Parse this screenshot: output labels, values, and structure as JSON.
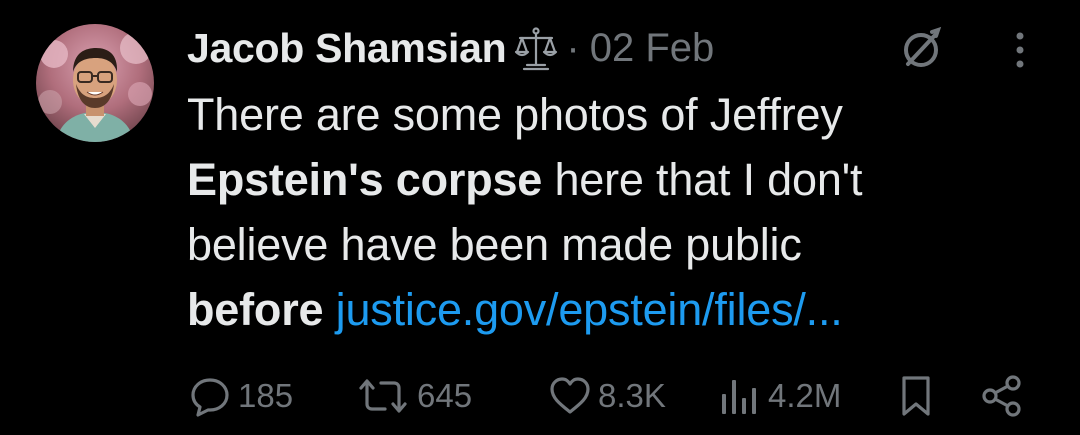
{
  "tweet": {
    "author": {
      "display_name": "Jacob Shamsian",
      "badge_icon": "scales-of-justice-icon"
    },
    "dot": "·",
    "timestamp": "02 Feb",
    "body": {
      "line1": "There are some photos of Jeffrey",
      "bold1": "Epstein's corpse",
      "line2_rest": " here that I don't",
      "line3": "believe have been made public",
      "bold2": "before",
      "link": "justice.gov/epstein/files/..."
    },
    "metrics": {
      "replies": "185",
      "reposts": "645",
      "likes": "8.3K",
      "views": "4.2M"
    }
  },
  "colors": {
    "background": "#000000",
    "text_primary": "#e7e9ea",
    "text_secondary": "#71767b",
    "link": "#1d9bf0"
  }
}
